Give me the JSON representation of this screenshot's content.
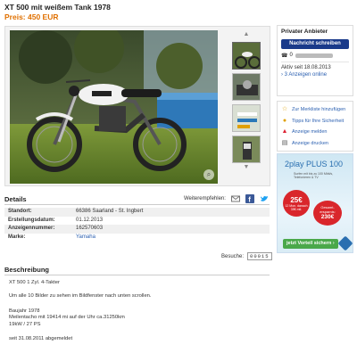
{
  "listing": {
    "title": "XT 500 mit weißem Tank 1978",
    "price": "Preis: 450 EUR"
  },
  "gallery": {
    "zoom_icon": "magnifier-icon",
    "thumb_up": "▲",
    "thumb_down": "▼"
  },
  "details": {
    "heading": "Details",
    "share_label": "Weiterempfehlen:",
    "rows": [
      {
        "key": "Standort:",
        "value": "66386 Saarland - St. Ingbert",
        "link": false
      },
      {
        "key": "Erstellungsdatum:",
        "value": "01.12.2013",
        "link": false
      },
      {
        "key": "Anzeigennummer:",
        "value": "162570603",
        "link": false
      },
      {
        "key": "Marke:",
        "value": "Yamaha",
        "link": true
      }
    ],
    "views_label": "Besuche:",
    "views_count": "00015"
  },
  "description": {
    "heading": "Beschreibung",
    "lines": [
      "XT 500 1 Zyl. 4-Takter",
      "Um alle 10 Bilder zu sehen im Bildfenster nach unten scrollen.",
      "Baujahr 1978",
      "Meilentacho mit 19414 mi auf der Uhr ca.31250km",
      "19kW / 27 PS",
      "seit 31.08.2011 abgemeldet"
    ]
  },
  "seller": {
    "heading": "Privater Anbieter",
    "message_button": "Nachricht schreiben",
    "phone_prefix": "0",
    "since": "Aktiv seit 18.08.2013",
    "ads_link": "3 Anzeigen online"
  },
  "actions": [
    {
      "icon": "star-icon",
      "glyph": "☆",
      "label": "Zur Merkliste hinzufügen",
      "color": "#e0a000"
    },
    {
      "icon": "lightbulb-icon",
      "glyph": "●",
      "label": "Tipps für Ihre Sicherheit",
      "color": "#e0a000"
    },
    {
      "icon": "warning-icon",
      "glyph": "▲",
      "label": "Anzeige melden",
      "color": "#d23"
    },
    {
      "icon": "printer-icon",
      "glyph": "▤",
      "label": "Anzeige drucken",
      "color": "#555"
    }
  ],
  "ad": {
    "title": "2play PLUS 100",
    "subtitle": "Surfen mit bis zu 100 Mbit/s, Telefonieren & TV",
    "bubble1_price": "25€",
    "bubble1_note": "12 Mon. danach 35€ mtl.",
    "bubble2_note": "Gesamt-ersparnis:",
    "bubble2_value": "230€",
    "button": "jetzt Vorteil sichern ›"
  },
  "colors": {
    "price": "#e07000",
    "link": "#2a5fb0",
    "primary_button": "#1a3a8a"
  }
}
